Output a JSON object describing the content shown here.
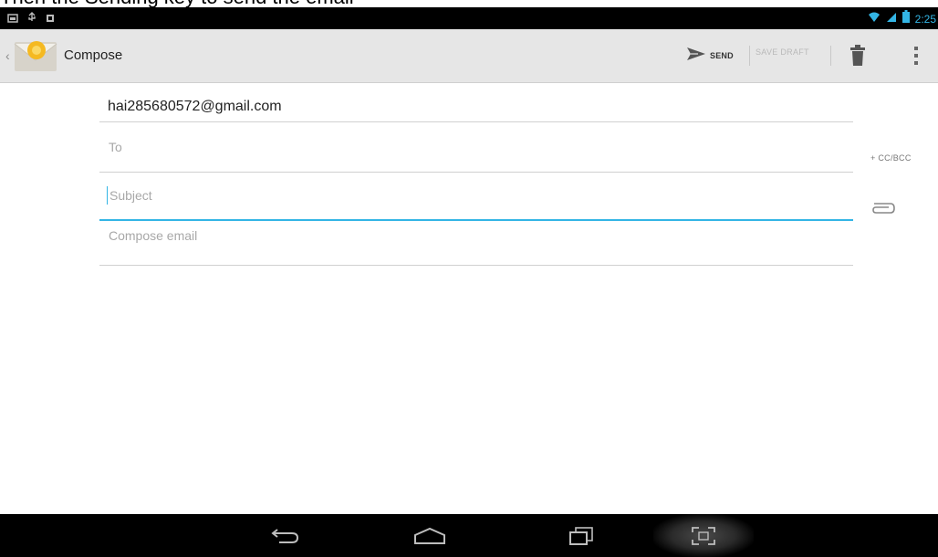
{
  "caption": "Then the Sending key to send the email",
  "status_bar": {
    "time": "2:25",
    "left_icons": [
      "screenshot-icon",
      "usb-icon",
      "notification-icon"
    ],
    "right_icons": [
      "wifi-icon",
      "signal-icon",
      "battery-icon"
    ]
  },
  "action_bar": {
    "title": "Compose",
    "send_label": "SEND",
    "save_draft_label": "SAVE DRAFT"
  },
  "compose": {
    "from_value": "hai285680572@gmail.com",
    "to_placeholder": "To",
    "cc_bcc_label": "+ CC/BCC",
    "subject_placeholder": "Subject",
    "body_placeholder": "Compose email"
  },
  "colors": {
    "accent": "#33b5e5",
    "action_bar": "#e6e6e6",
    "system_bar": "#000000"
  }
}
